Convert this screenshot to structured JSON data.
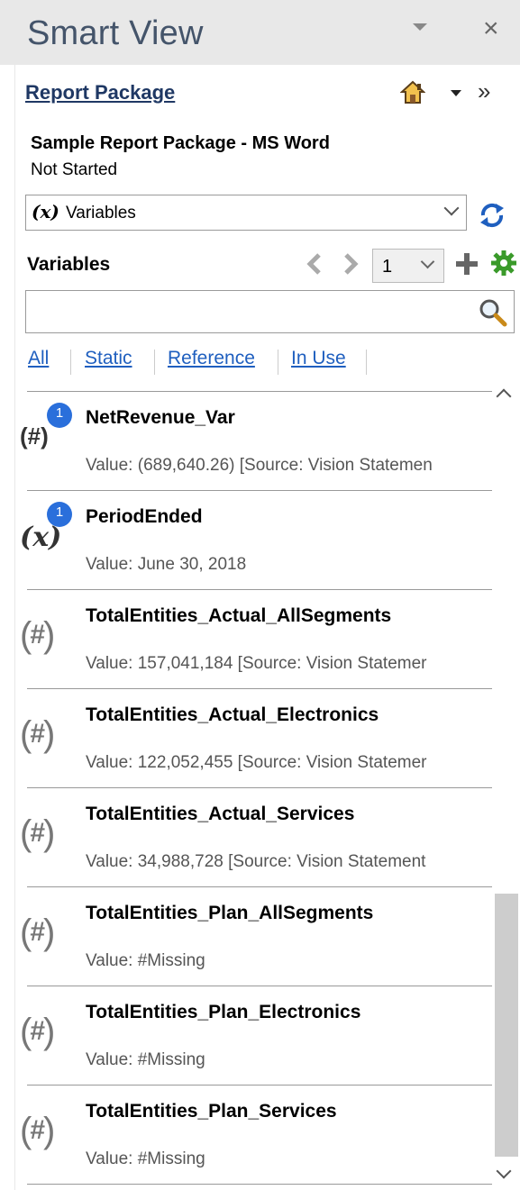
{
  "window": {
    "title": "Smart View",
    "menu_icon": "triangle-down-icon",
    "close_glyph": "×"
  },
  "package": {
    "link_label": "Report Package",
    "expand_glyph": "»",
    "name": "Sample Report Package - MS Word",
    "status": "Not Started"
  },
  "view_select": {
    "icon_text": "(x)",
    "value": "Variables"
  },
  "variables": {
    "label": "Variables",
    "page": "1",
    "search_placeholder": ""
  },
  "filters": {
    "all": "All",
    "static": "Static",
    "reference": "Reference",
    "in_use": "In Use"
  },
  "items": [
    {
      "name": "NetRevenue_Var",
      "value": "Value:  (689,640.26) [Source: Vision Statemen",
      "icon": "hash",
      "badge": "1"
    },
    {
      "name": "PeriodEnded",
      "value": "Value: June 30, 2018",
      "icon": "x",
      "badge": "1"
    },
    {
      "name": "TotalEntities_Actual_AllSegments",
      "value": "Value:  157,041,184  [Source: Vision Statemer",
      "icon": "hash",
      "badge": ""
    },
    {
      "name": "TotalEntities_Actual_Electronics",
      "value": "Value:  122,052,455  [Source: Vision Statemer",
      "icon": "hash",
      "badge": ""
    },
    {
      "name": "TotalEntities_Actual_Services",
      "value": "Value:  34,988,728  [Source: Vision Statement",
      "icon": "hash",
      "badge": ""
    },
    {
      "name": "TotalEntities_Plan_AllSegments",
      "value": "Value: #Missing",
      "icon": "hash",
      "badge": ""
    },
    {
      "name": "TotalEntities_Plan_Electronics",
      "value": "Value: #Missing",
      "icon": "hash",
      "badge": ""
    },
    {
      "name": "TotalEntities_Plan_Services",
      "value": "Value: #Missing",
      "icon": "hash",
      "badge": ""
    }
  ],
  "colors": {
    "title": "#44546a",
    "link": "#1f5fbf",
    "badge": "#2a6fdb",
    "gear": "#3a9a2a",
    "refresh": "#1f5fbf"
  }
}
